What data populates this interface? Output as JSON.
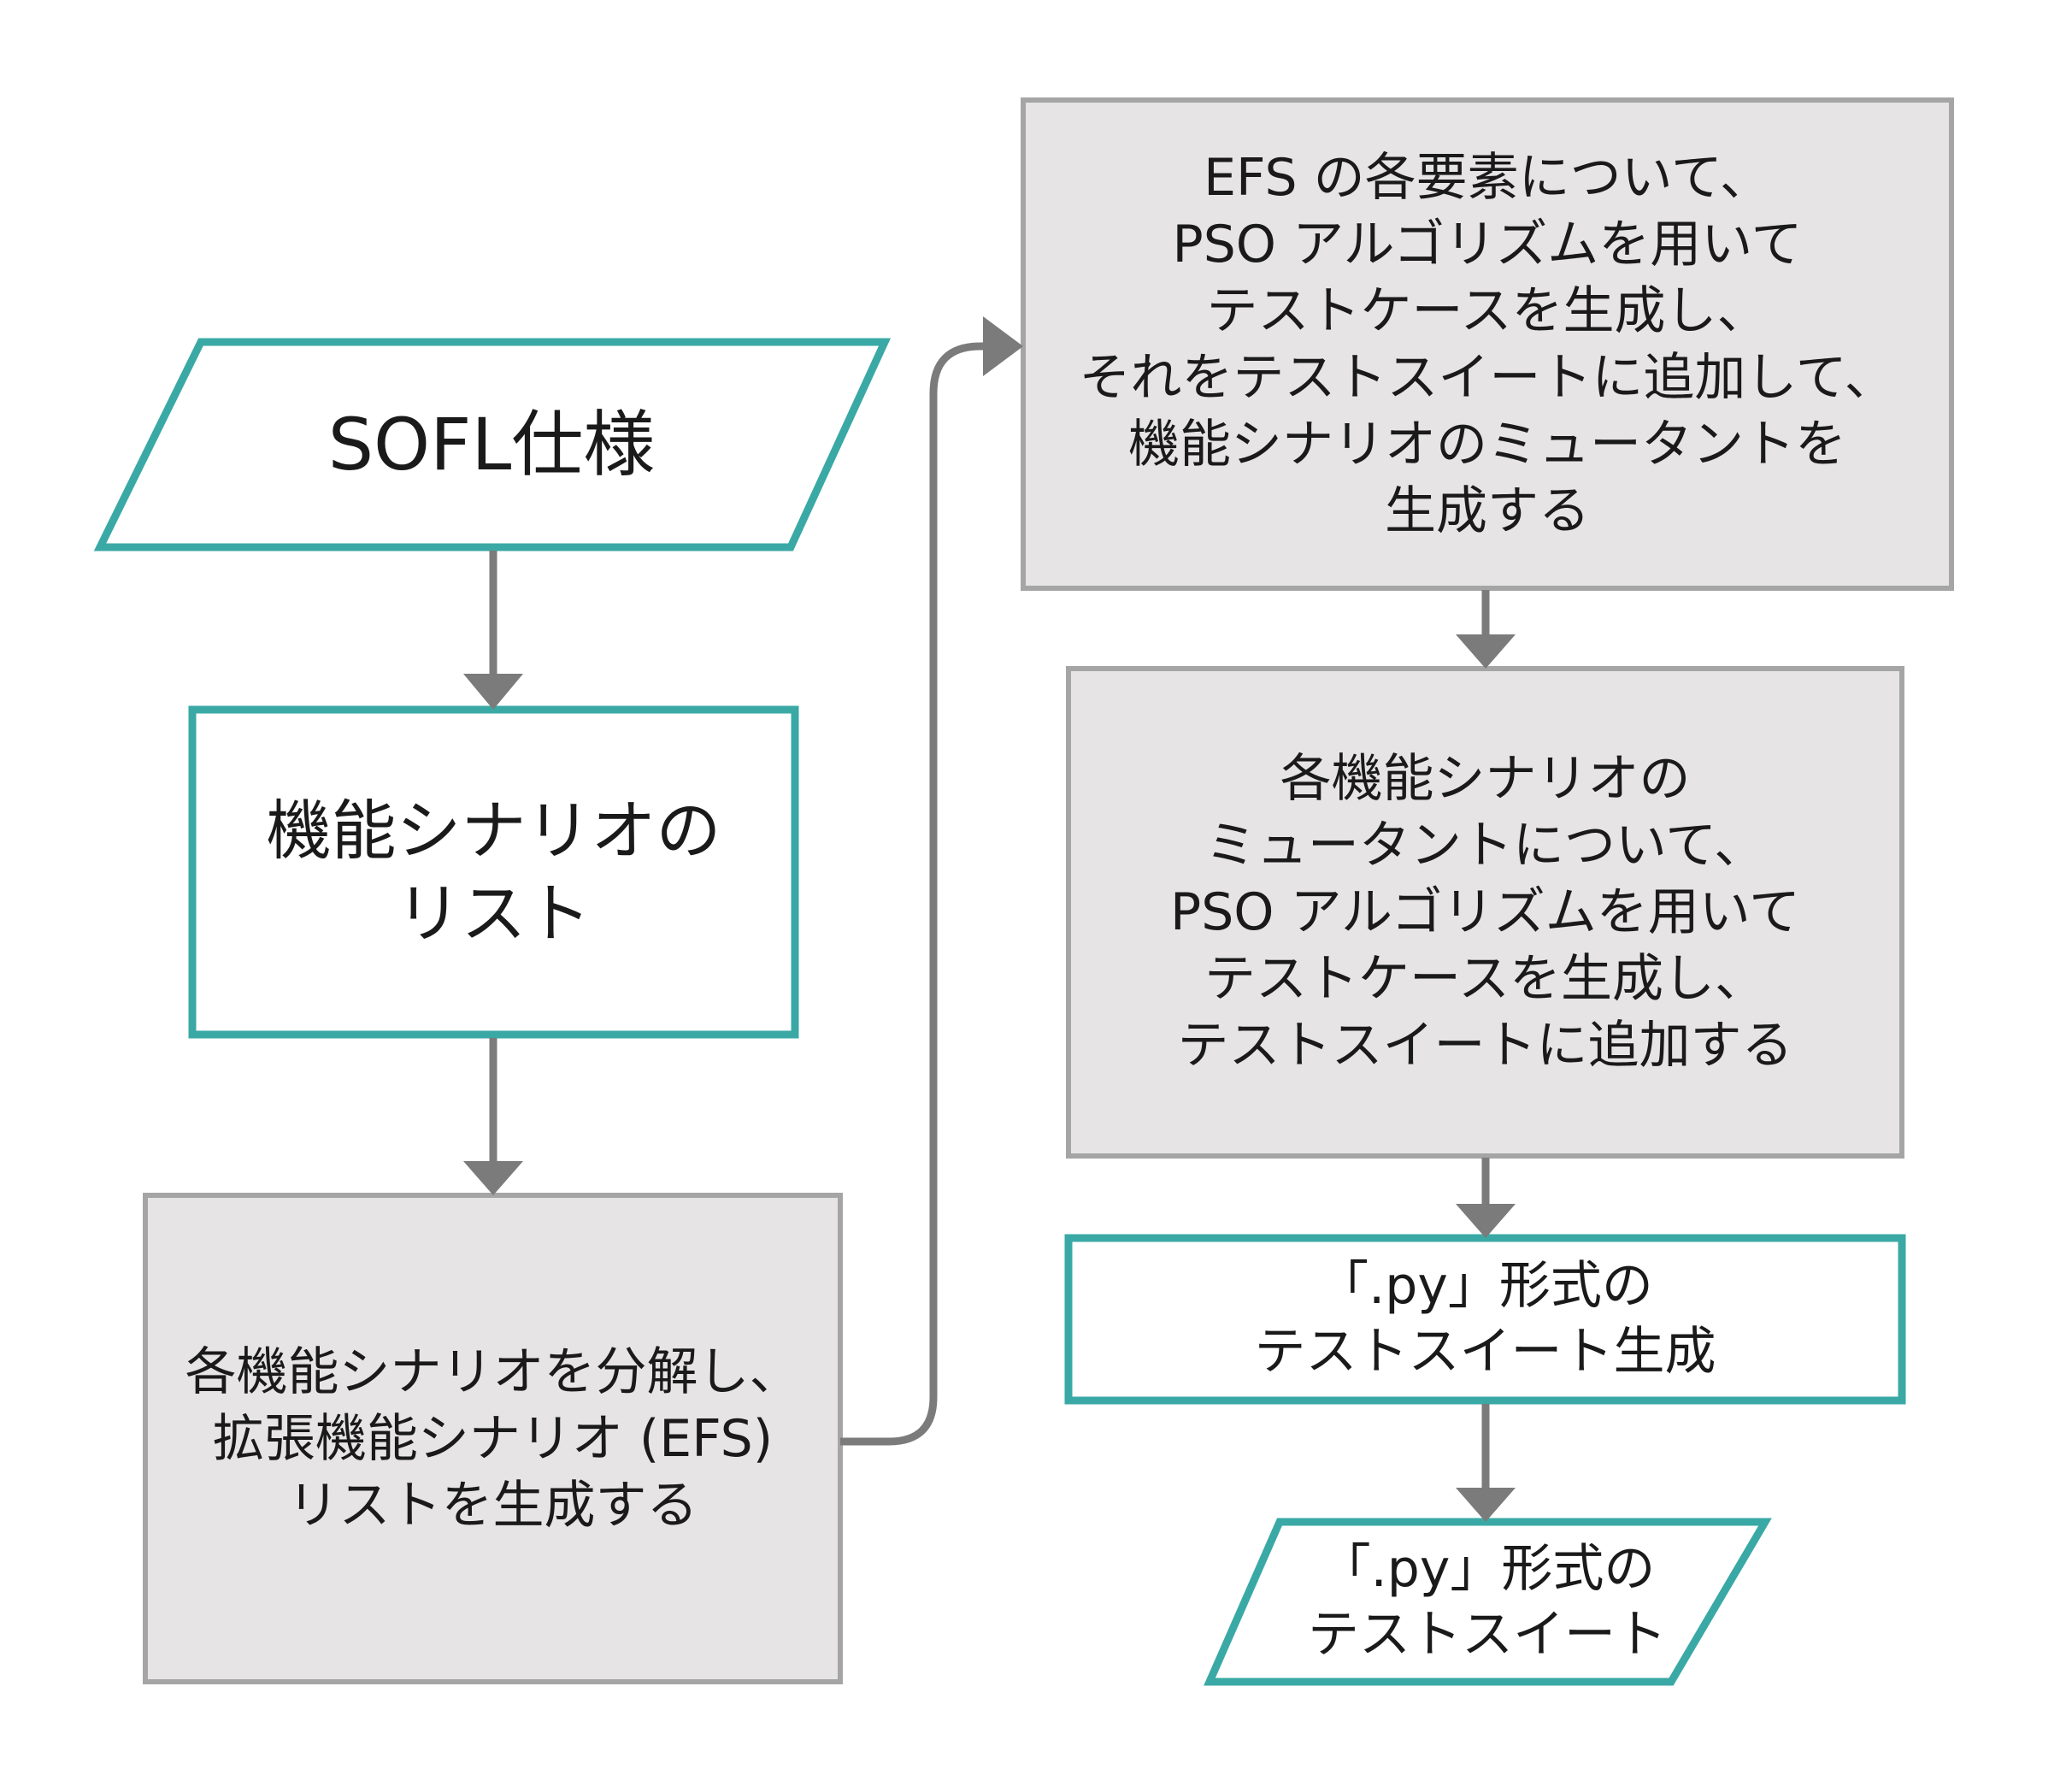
{
  "colors": {
    "teal": "#3aa9a5",
    "gray_fill": "#e6e4e5",
    "gray_border": "#a5a5a5",
    "arrow": "#7b7b7b",
    "text": "#1a1a1a"
  },
  "nodes": {
    "sofl_spec": {
      "shape": "parallelogram",
      "lines": [
        "SOFL仕様"
      ]
    },
    "scenario_list": {
      "shape": "rectangle",
      "lines": [
        "機能シナリオの",
        "リスト"
      ]
    },
    "decompose": {
      "shape": "rectangle",
      "lines": [
        "各機能シナリオを分解し、",
        "拡張機能シナリオ (EFS)",
        "リストを生成する"
      ]
    },
    "efs_pso": {
      "shape": "rectangle",
      "lines": [
        "EFS の各要素について、",
        "PSO アルゴリズムを用いて",
        "テストケースを生成し、",
        "それをテストスイートに追加して、",
        "機能シナリオのミュータントを",
        "生成する"
      ]
    },
    "mutant_pso": {
      "shape": "rectangle",
      "lines": [
        "各機能シナリオの",
        "ミュータントについて、",
        "PSO アルゴリズムを用いて",
        "テストケースを生成し、",
        "テストスイートに追加する"
      ]
    },
    "py_generate": {
      "shape": "rectangle",
      "lines": [
        "「.py」形式の",
        "テストスイート生成"
      ]
    },
    "py_output": {
      "shape": "parallelogram",
      "lines": [
        "「.py」形式の",
        "テストスイート"
      ]
    }
  }
}
